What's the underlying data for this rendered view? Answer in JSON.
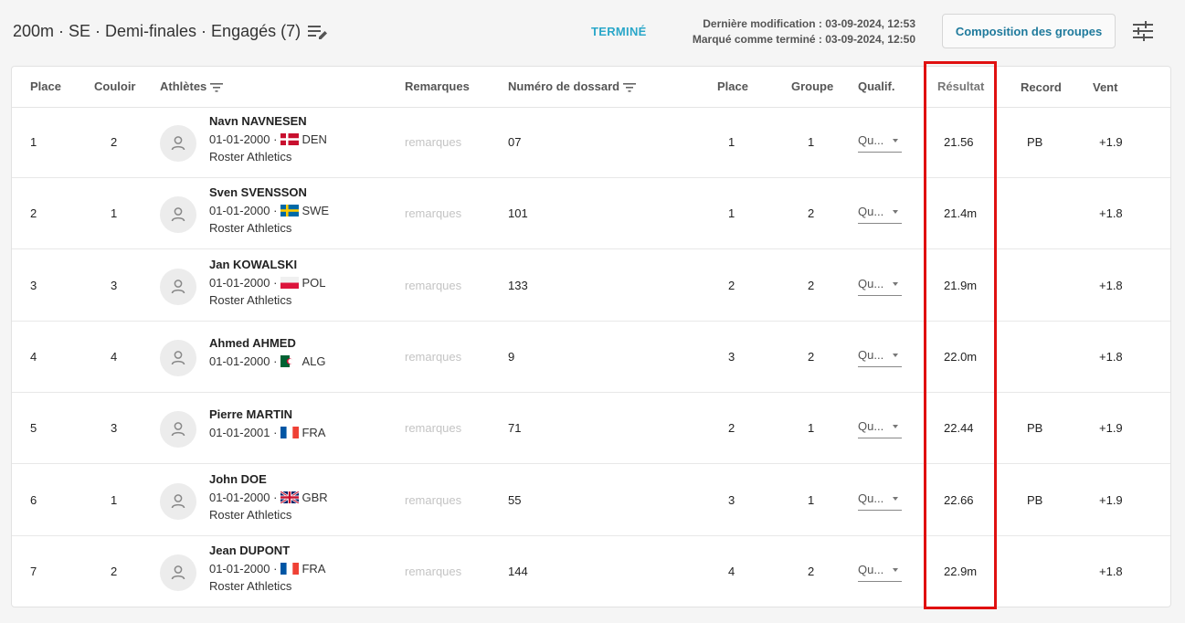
{
  "header": {
    "title": "200m · SE · Demi-finales · Engagés (7)",
    "status": "TERMINÉ",
    "last_modified": "Dernière modification : 03-09-2024, 12:53",
    "marked_done": "Marqué comme terminé : 03-09-2024, 12:50",
    "group_button": "Composition des groupes"
  },
  "columns": {
    "place": "Place",
    "lane": "Couloir",
    "athletes": "Athlètes",
    "remarks": "Remarques",
    "bib": "Numéro de dossard",
    "place2": "Place",
    "group": "Groupe",
    "qualif": "Qualif.",
    "result": "Résultat",
    "record": "Record",
    "wind": "Vent"
  },
  "colors": {
    "status": "#2aa7c9",
    "button_text": "#1f7a9c",
    "highlight": "#e01010"
  },
  "rows": [
    {
      "place": "1",
      "lane": "2",
      "name": "Navn NAVNESEN",
      "dob": "01-01-2000 ·",
      "flag": "DEN",
      "country": "DEN",
      "club": "Roster Athletics",
      "remark": "remarques",
      "bib": "07",
      "place2": "1",
      "group": "1",
      "qualif": "Qu...",
      "result": "21.56",
      "record": "PB",
      "wind": "+1.9"
    },
    {
      "place": "2",
      "lane": "1",
      "name": "Sven SVENSSON",
      "dob": "01-01-2000 ·",
      "flag": "SWE",
      "country": "SWE",
      "club": "Roster Athletics",
      "remark": "remarques",
      "bib": "101",
      "place2": "1",
      "group": "2",
      "qualif": "Qu...",
      "result": "21.4m",
      "record": "",
      "wind": "+1.8"
    },
    {
      "place": "3",
      "lane": "3",
      "name": "Jan KOWALSKI",
      "dob": "01-01-2000 ·",
      "flag": "POL",
      "country": "POL",
      "club": "Roster Athletics",
      "remark": "remarques",
      "bib": "133",
      "place2": "2",
      "group": "2",
      "qualif": "Qu...",
      "result": "21.9m",
      "record": "",
      "wind": "+1.8"
    },
    {
      "place": "4",
      "lane": "4",
      "name": "Ahmed AHMED",
      "dob": "01-01-2000 ·",
      "flag": "ALG",
      "country": "ALG",
      "club": "",
      "remark": "remarques",
      "bib": "9",
      "place2": "3",
      "group": "2",
      "qualif": "Qu...",
      "result": "22.0m",
      "record": "",
      "wind": "+1.8"
    },
    {
      "place": "5",
      "lane": "3",
      "name": "Pierre MARTIN",
      "dob": "01-01-2001 ·",
      "flag": "FRA",
      "country": "FRA",
      "club": "",
      "remark": "remarques",
      "bib": "71",
      "place2": "2",
      "group": "1",
      "qualif": "Qu...",
      "result": "22.44",
      "record": "PB",
      "wind": "+1.9"
    },
    {
      "place": "6",
      "lane": "1",
      "name": "John DOE",
      "dob": "01-01-2000 ·",
      "flag": "GBR",
      "country": "GBR",
      "club": "Roster Athletics",
      "remark": "remarques",
      "bib": "55",
      "place2": "3",
      "group": "1",
      "qualif": "Qu...",
      "result": "22.66",
      "record": "PB",
      "wind": "+1.9"
    },
    {
      "place": "7",
      "lane": "2",
      "name": "Jean DUPONT",
      "dob": "01-01-2000 ·",
      "flag": "FRA",
      "country": "FRA",
      "club": "Roster Athletics",
      "remark": "remarques",
      "bib": "144",
      "place2": "4",
      "group": "2",
      "qualif": "Qu...",
      "result": "22.9m",
      "record": "",
      "wind": "+1.8"
    }
  ]
}
